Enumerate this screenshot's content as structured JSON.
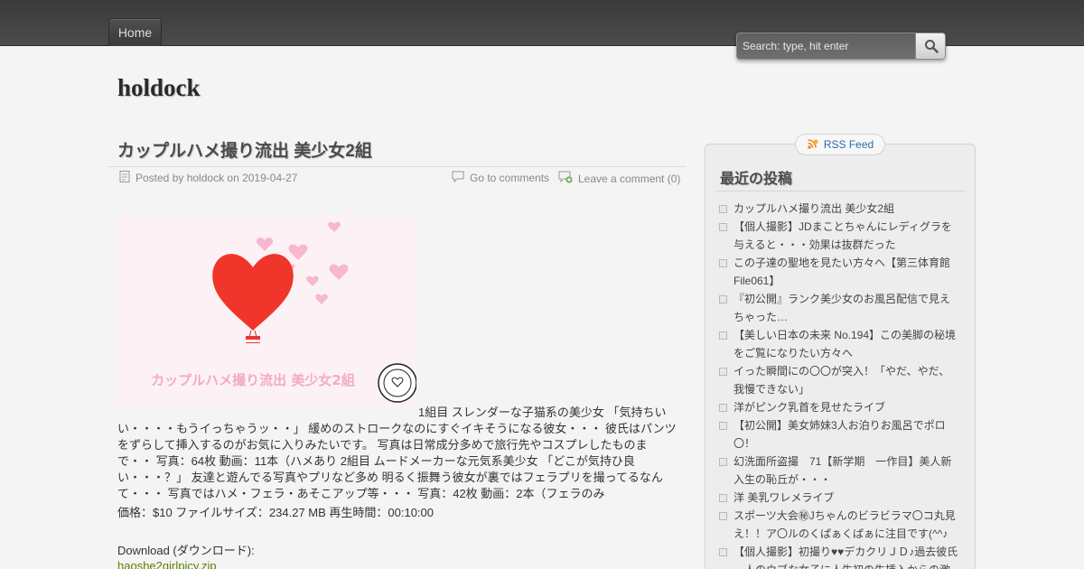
{
  "nav": {
    "home_label": "Home"
  },
  "search": {
    "placeholder": "Search: type, hit enter"
  },
  "site": {
    "title": "holdock"
  },
  "post": {
    "title": "カップルハメ撮り流出 美少女2組",
    "posted_by": "Posted by holdock on 2019-04-27",
    "go_to_comments": "Go to comments",
    "leave_comment": "Leave a comment (0)",
    "image_caption": "カップルハメ撮り流出 美少女2組",
    "body_lead": "1組目 スレンダーな子猫系の美少女 「気持ちい",
    "body_rest": "い・・・・もうイっちゃうッ・・」 緩めのストロークなのにすぐイキそうになる彼女・・・ 彼氏はパンツをずらして挿入するのがお気に入りみたいです。 写真は日常成分多めで旅行先やコスプレしたものまで・・ 写真：64枚 動画：11本（ハメあり 2組目 ムードメーカーな元気系美少女 「どこが気持ひ良い・・・？」 友達と遊んでる写真やプリなど多め 明るく振舞う彼女が裏ではフェラプリを撮ってるなんて・・・ 写真ではハメ・フェラ・あそこアップ等・・・ 写真：42枚 動画：2本（フェラのみ",
    "price": "価格：$10 ファイルサイズ：234.27 MB 再生時間：00:10:00",
    "download_label": "Download (ダウンロード):",
    "download_link": "haoshe2girlpicy.zip"
  },
  "sidebar": {
    "rss_label": "RSS Feed",
    "widget_title": "最近の投稿",
    "recent_posts": [
      "カップルハメ撮り流出 美少女2組",
      "【個人撮影】JDまことちゃんにレディグラを与えると・・・効果は抜群だった",
      "この子達の聖地を見たい方々へ【第三体育館File061】",
      "『初公開』ランク美少女のお風呂配信で見えちゃった…",
      "【美しい日本の未来 No.194】この美脚の秘境をご覧になりたい方々へ",
      "イった瞬間にの〇〇が突入！「やだ、やだ、我慢できない」",
      "洋がピンク乳首を見せたライブ",
      "【初公開】美女姉妹3人お泊りお風呂でポロ〇！",
      "幻洗面所盗撮　71【新学期　一作目】美人新入生の恥丘が・・・",
      "洋 美乳ワレメライブ",
      "スポーツ大会㊙Jちゃんのビラビラマ〇コ丸見え！！ア〇ルのくぱぁくぱぁに注目です(^^♪",
      "【個人撮影】初撮り♥♥デカクリＪＤ♪過去彼氏一人のウブな女子に人生初の生挿入からの激"
    ]
  },
  "colors": {
    "link": "#5b7d00",
    "rss": "#2b6da8",
    "topbar": "#444444"
  }
}
